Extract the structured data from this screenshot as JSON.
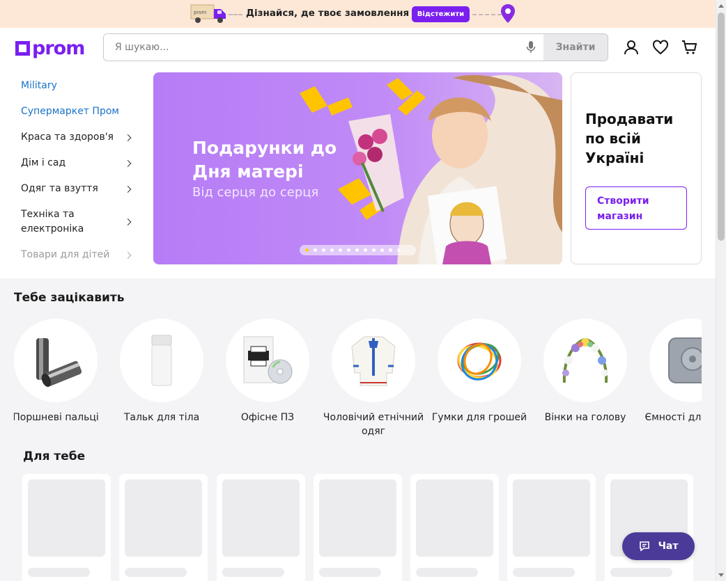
{
  "promo": {
    "truck_text": "prom",
    "text": "Дізнайся, де твоє замовлення",
    "track_button": "Відстежити"
  },
  "header": {
    "logo": "prom",
    "search_placeholder": "Я шукаю...",
    "search_button": "Знайти",
    "icons": [
      "microphone-icon",
      "user-icon",
      "heart-icon",
      "cart-icon"
    ]
  },
  "sidebar": {
    "items": [
      {
        "label": "Military",
        "style": "link",
        "chevron": false
      },
      {
        "label": "Супермаркет Пром",
        "style": "link",
        "chevron": false
      },
      {
        "label": "Краса та здоров'я",
        "style": "normal",
        "chevron": true
      },
      {
        "label": "Дім і сад",
        "style": "normal",
        "chevron": true
      },
      {
        "label": "Одяг та взуття",
        "style": "normal",
        "chevron": true
      },
      {
        "label": "Техніка та електроніка",
        "style": "normal",
        "chevron": true
      },
      {
        "label": "Товари для дітей",
        "style": "faded",
        "chevron": true
      }
    ]
  },
  "banner": {
    "title": "Подарунки до Дня матері",
    "subtitle": "Від серця до серця",
    "slides_count": 12,
    "active_slide": 0
  },
  "sell_card": {
    "title": "Продавати по всій Україні",
    "button": "Створити магазин"
  },
  "interest": {
    "title": "Тебе зацікавить",
    "items": [
      {
        "label": "Поршневі пальці",
        "icon": "piston-pin-icon"
      },
      {
        "label": "Тальк для тіла",
        "icon": "talc-bottle-icon"
      },
      {
        "label": "Офісне ПЗ",
        "icon": "software-box-icon"
      },
      {
        "label": "Чоловічий етнічний одяг",
        "icon": "embroidered-shirt-icon"
      },
      {
        "label": "Гумки для грошей",
        "icon": "rubber-bands-icon"
      },
      {
        "label": "Вінки на голову",
        "icon": "flower-wreath-icon"
      },
      {
        "label": "Ємності для душа",
        "icon": "water-tank-icon"
      }
    ]
  },
  "for_you": {
    "title": "Для тебе",
    "placeholder_cards": 7
  },
  "chat": {
    "label": "Чат"
  },
  "colors": {
    "brand": "#7a1ff0",
    "link": "#1a73c8",
    "chat": "#4c3a99",
    "promo_bg": "#fde8d8"
  }
}
